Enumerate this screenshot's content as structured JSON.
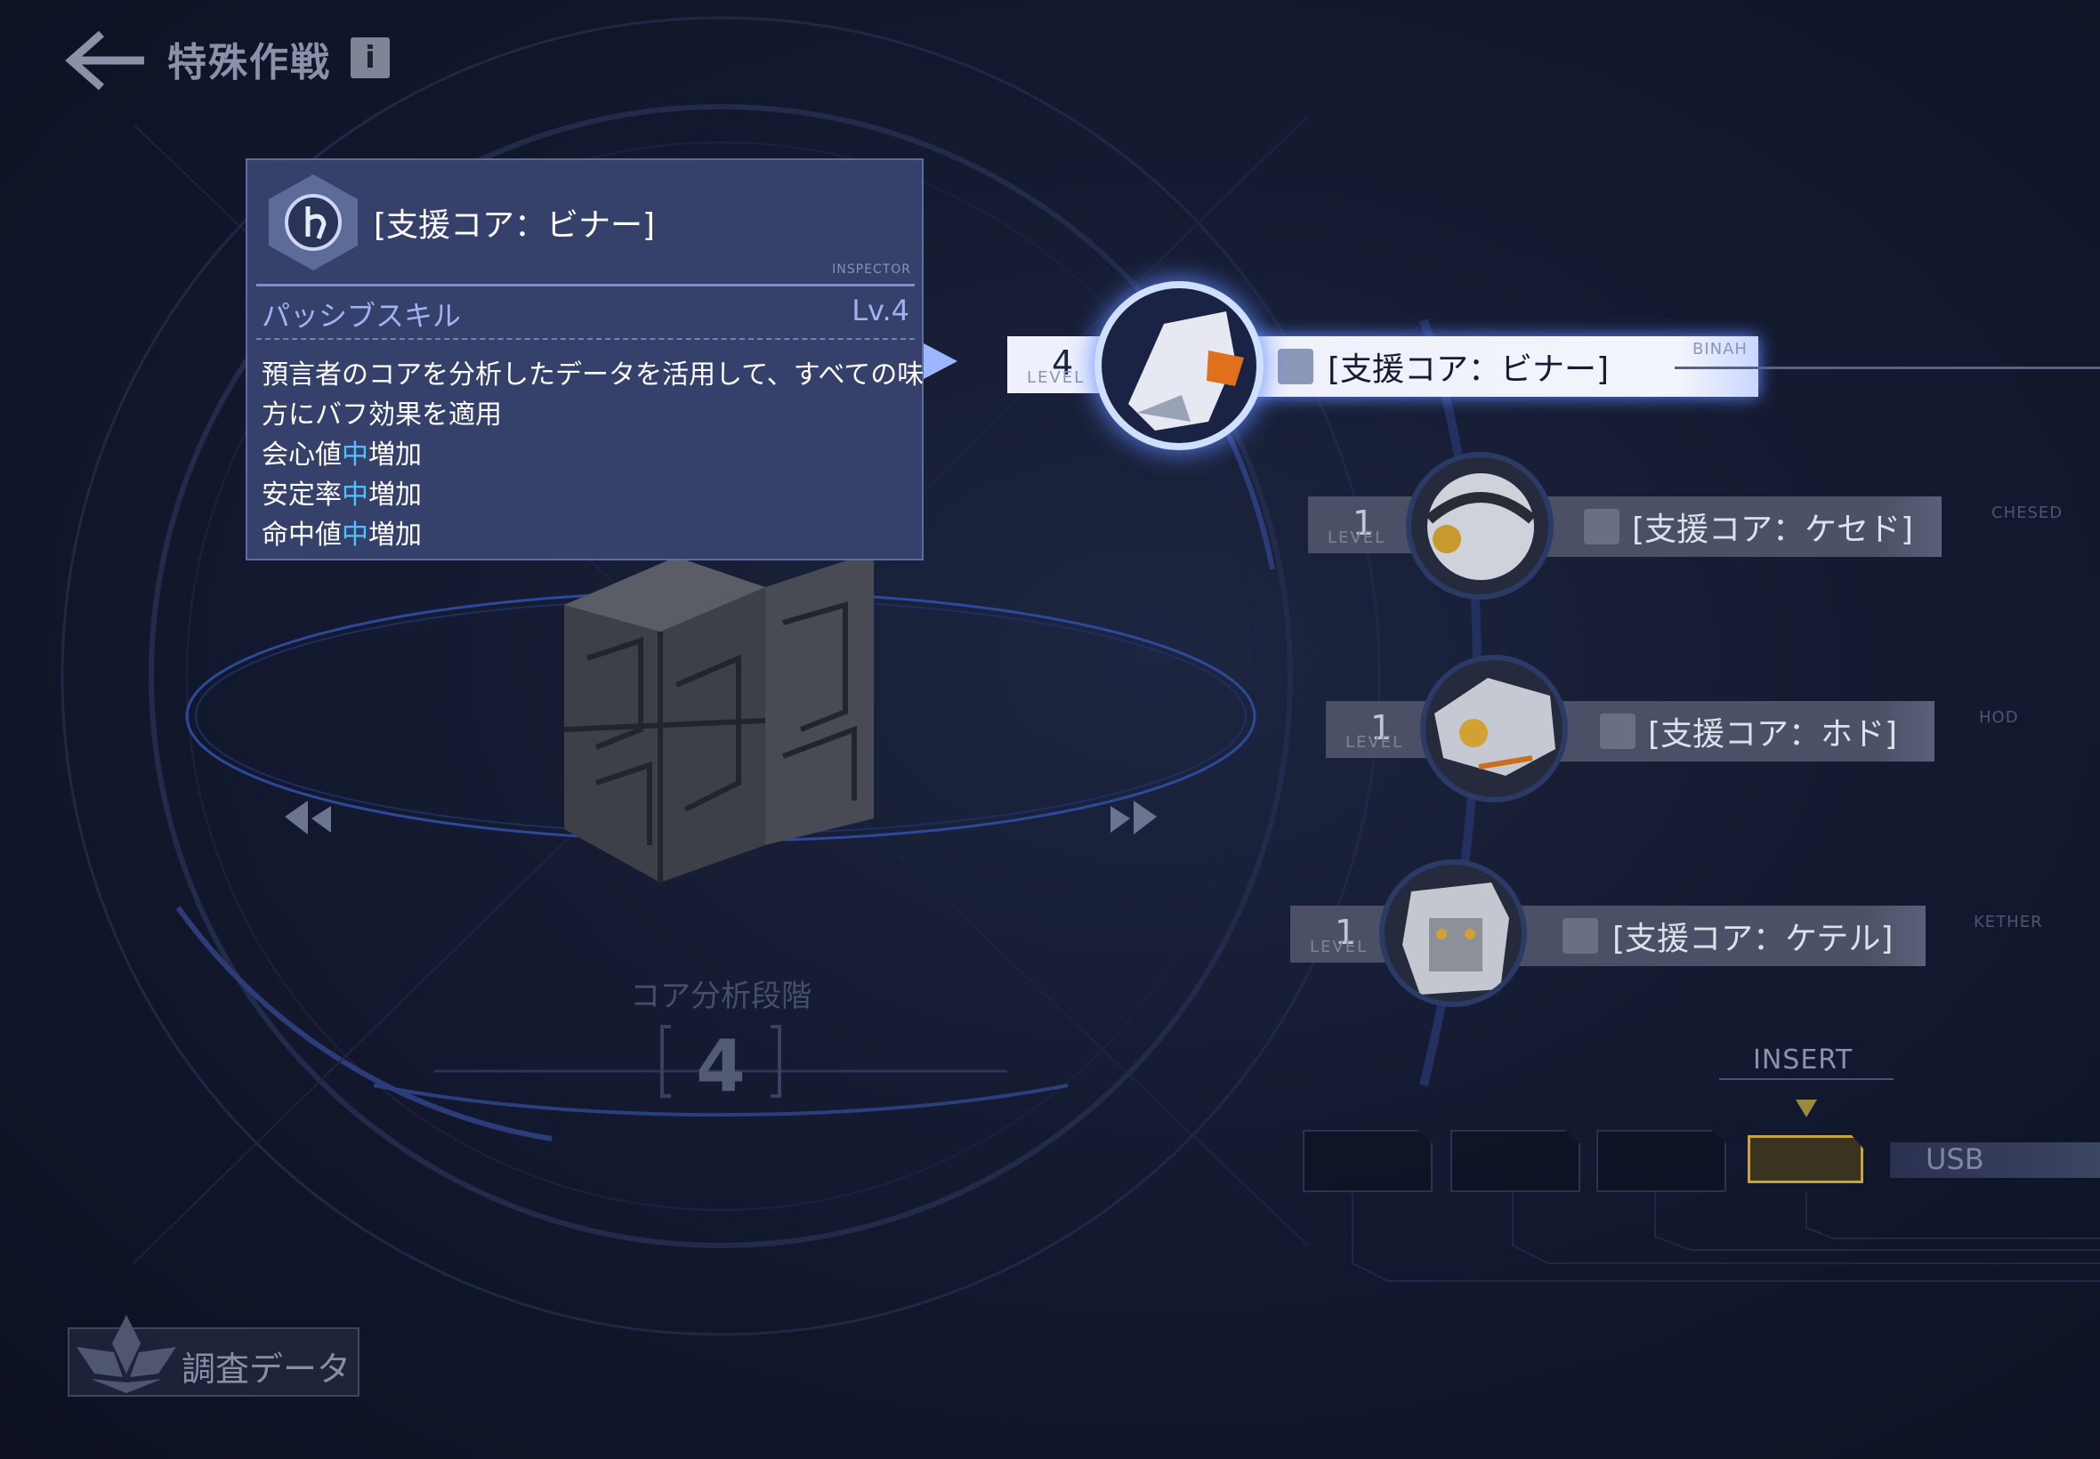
{
  "header": {
    "title": "特殊作戦",
    "info_icon": "i"
  },
  "tooltip": {
    "title": "[支援コア：ビナー]",
    "inspector": "INSPECTOR",
    "skill_type": "パッシブスキル",
    "skill_level": "Lv.4",
    "desc_line1": "預言者のコアを分析したデータを活用して、すべての味",
    "desc_line2": "方にバフ効果を適用",
    "effects": [
      {
        "stat": "会心値",
        "amount": "中",
        "suffix": "増加"
      },
      {
        "stat": "安定率",
        "amount": "中",
        "suffix": "増加"
      },
      {
        "stat": "命中値",
        "amount": "中",
        "suffix": "増加"
      }
    ]
  },
  "stage": {
    "label": "コア分析段階",
    "value": "4"
  },
  "research": {
    "label": "調査データ"
  },
  "level_tag": "LEVEL",
  "cores": [
    {
      "level": "4",
      "name": "[支援コア：ビナー]",
      "tag": "BINAH",
      "active": true
    },
    {
      "level": "1",
      "name": "[支援コア：ケセド]",
      "tag": "CHESED",
      "active": false
    },
    {
      "level": "1",
      "name": "[支援コア：ホド]",
      "tag": "HOD",
      "active": false
    },
    {
      "level": "1",
      "name": "[支援コア：ケテル]",
      "tag": "KETHER",
      "active": false
    }
  ],
  "insert": {
    "label": "INSERT",
    "usb": "USB"
  },
  "colors": {
    "highlight": "#4ec2ff",
    "panel": "#35416a",
    "slot_active": "#c9a43c",
    "accent_glow": "#5f87ff"
  }
}
